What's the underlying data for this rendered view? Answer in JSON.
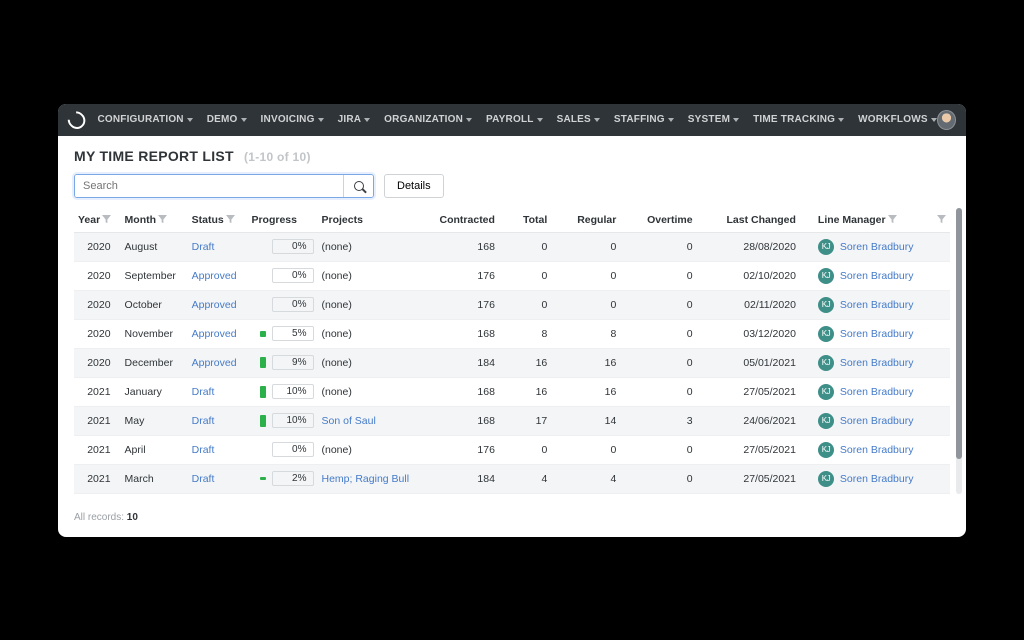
{
  "menu": [
    "CONFIGURATION",
    "DEMO",
    "INVOICING",
    "JIRA",
    "ORGANIZATION",
    "PAYROLL",
    "SALES",
    "STAFFING",
    "SYSTEM",
    "TIME TRACKING",
    "WORKFLOWS"
  ],
  "page": {
    "title": "MY TIME REPORT LIST",
    "subtitle": "(1-10 of 10)"
  },
  "search": {
    "placeholder": "Search",
    "value": ""
  },
  "buttons": {
    "details": "Details"
  },
  "columns": [
    "Year",
    "Month",
    "Status",
    "Progress",
    "Projects",
    "Contracted",
    "Total",
    "Regular",
    "Overtime",
    "Last Changed",
    "Line Manager"
  ],
  "filterable_cols": [
    0,
    1,
    2,
    10
  ],
  "manager": {
    "name": "Soren Bradbury",
    "initials": "KJ"
  },
  "rows": [
    {
      "year": "2020",
      "month": "August",
      "status": "Draft",
      "progress": 0,
      "projects": "(none)",
      "project_link": false,
      "contracted": 168,
      "total": 0,
      "regular": 0,
      "overtime": 0,
      "last_changed": "28/08/2020"
    },
    {
      "year": "2020",
      "month": "September",
      "status": "Approved",
      "progress": 0,
      "projects": "(none)",
      "project_link": false,
      "contracted": 176,
      "total": 0,
      "regular": 0,
      "overtime": 0,
      "last_changed": "02/10/2020"
    },
    {
      "year": "2020",
      "month": "October",
      "status": "Approved",
      "progress": 0,
      "projects": "(none)",
      "project_link": false,
      "contracted": 176,
      "total": 0,
      "regular": 0,
      "overtime": 0,
      "last_changed": "02/11/2020"
    },
    {
      "year": "2020",
      "month": "November",
      "status": "Approved",
      "progress": 5,
      "projects": "(none)",
      "project_link": false,
      "contracted": 168,
      "total": 8,
      "regular": 8,
      "overtime": 0,
      "last_changed": "03/12/2020"
    },
    {
      "year": "2020",
      "month": "December",
      "status": "Approved",
      "progress": 9,
      "projects": "(none)",
      "project_link": false,
      "contracted": 184,
      "total": 16,
      "regular": 16,
      "overtime": 0,
      "last_changed": "05/01/2021"
    },
    {
      "year": "2021",
      "month": "January",
      "status": "Draft",
      "progress": 10,
      "projects": "(none)",
      "project_link": false,
      "contracted": 168,
      "total": 16,
      "regular": 16,
      "overtime": 0,
      "last_changed": "27/05/2021"
    },
    {
      "year": "2021",
      "month": "May",
      "status": "Draft",
      "progress": 10,
      "projects": "Son of Saul",
      "project_link": true,
      "contracted": 168,
      "total": 17,
      "regular": 14,
      "overtime": 3,
      "last_changed": "24/06/2021"
    },
    {
      "year": "2021",
      "month": "April",
      "status": "Draft",
      "progress": 0,
      "projects": "(none)",
      "project_link": false,
      "contracted": 176,
      "total": 0,
      "regular": 0,
      "overtime": 0,
      "last_changed": "27/05/2021"
    },
    {
      "year": "2021",
      "month": "March",
      "status": "Draft",
      "progress": 2,
      "projects": "Hemp; Raging Bull",
      "project_link": true,
      "contracted": 184,
      "total": 4,
      "regular": 4,
      "overtime": 0,
      "last_changed": "27/05/2021"
    }
  ],
  "footer": {
    "label": "All records:",
    "count": "10"
  }
}
